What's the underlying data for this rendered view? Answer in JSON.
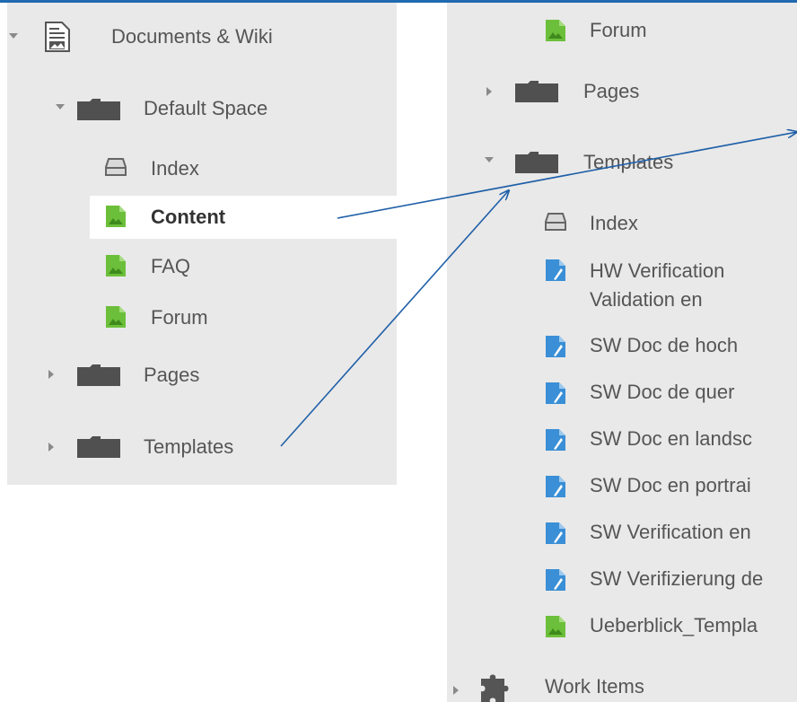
{
  "left_panel": {
    "root": {
      "label": "Documents & Wiki",
      "icon": "document-wiki-icon"
    },
    "space": {
      "label": "Default Space",
      "icon": "folder-icon"
    },
    "pages": [
      {
        "label": "Index",
        "icon": "tray-icon",
        "selected": false
      },
      {
        "label": "Content",
        "icon": "image-page-icon",
        "selected": true
      },
      {
        "label": "FAQ",
        "icon": "image-page-icon",
        "selected": false
      },
      {
        "label": "Forum",
        "icon": "image-page-icon",
        "selected": false
      }
    ],
    "folders": [
      {
        "label": "Pages",
        "icon": "folder-icon"
      },
      {
        "label": "Templates",
        "icon": "folder-icon"
      }
    ]
  },
  "right_panel": {
    "forum": {
      "label": "Forum",
      "icon": "image-page-icon"
    },
    "pages": {
      "label": "Pages",
      "icon": "folder-icon"
    },
    "templates": {
      "label": "Templates",
      "icon": "folder-icon"
    },
    "template_items": [
      {
        "label": "Index",
        "icon": "tray-icon"
      },
      {
        "label": "HW Verification",
        "label2": "Validation en",
        "icon": "blue-doc-icon"
      },
      {
        "label": "SW Doc de hoch",
        "icon": "blue-doc-icon"
      },
      {
        "label": "SW Doc de quer",
        "icon": "blue-doc-icon"
      },
      {
        "label": "SW Doc en landsc",
        "icon": "blue-doc-icon"
      },
      {
        "label": "SW Doc en portrai",
        "icon": "blue-doc-icon"
      },
      {
        "label": "SW Verification en",
        "icon": "blue-doc-icon"
      },
      {
        "label": "SW Verifizierung de",
        "icon": "blue-doc-icon"
      },
      {
        "label": "Ueberblick_Templa",
        "icon": "image-page-icon"
      }
    ],
    "work_items": {
      "label": "Work Items",
      "icon": "puzzle-icon"
    }
  },
  "colors": {
    "accent_line": "#1f6ab0",
    "arrow": "#1f5fa8",
    "panel_bg": "#e9e9e9",
    "folder": "#555555",
    "image_icon_green": "#6cbf3a",
    "doc_icon_blue": "#3a8fd6"
  }
}
